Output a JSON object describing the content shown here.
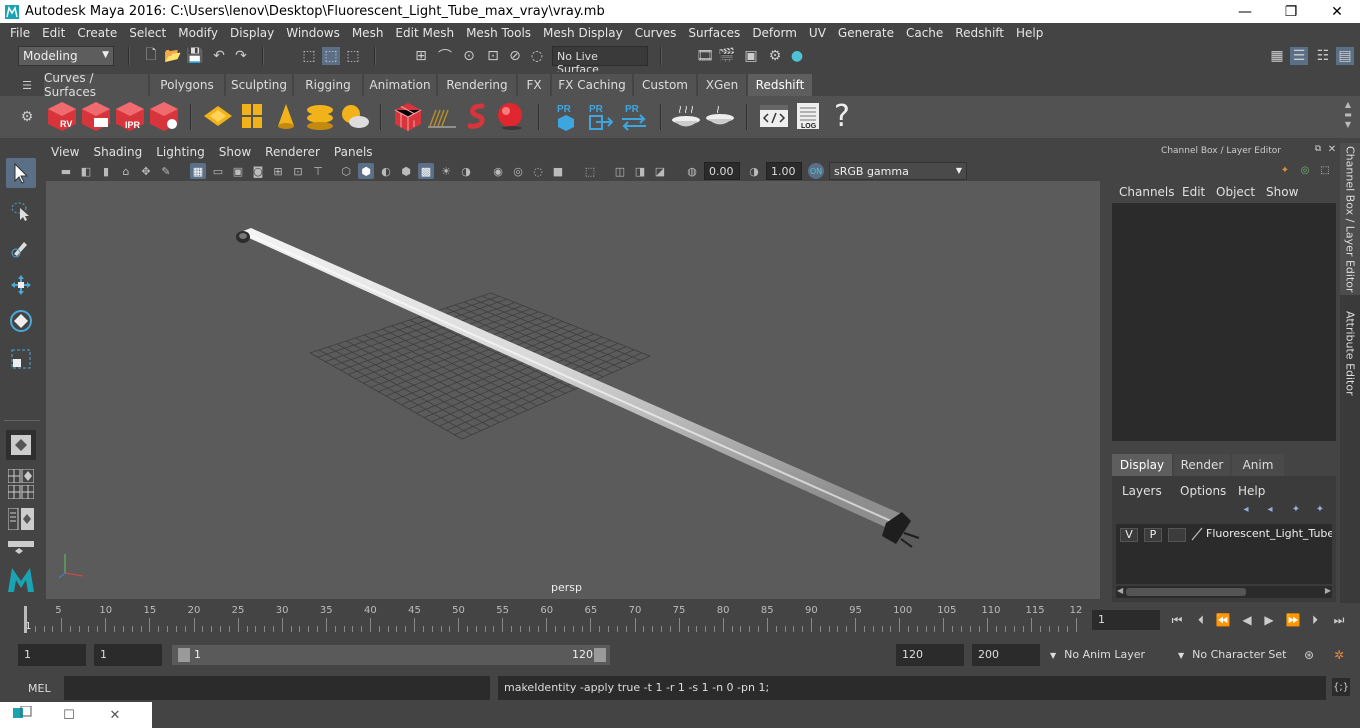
{
  "window": {
    "title": "Autodesk Maya 2016: C:\\Users\\lenov\\Desktop\\Fluorescent_Light_Tube_max_vray\\vray.mb",
    "minimize": "—",
    "maximize": "❐",
    "close": "✕"
  },
  "menubar": [
    "File",
    "Edit",
    "Create",
    "Select",
    "Modify",
    "Display",
    "Windows",
    "Mesh",
    "Edit Mesh",
    "Mesh Tools",
    "Mesh Display",
    "Curves",
    "Surfaces",
    "Deform",
    "UV",
    "Generate",
    "Cache",
    "Redshift",
    "Help"
  ],
  "status": {
    "mode": "Modeling",
    "live_surface": "No Live Surface"
  },
  "shelf_tabs": [
    "Curves / Surfaces",
    "Polygons",
    "Sculpting",
    "Rigging",
    "Animation",
    "Rendering",
    "FX",
    "FX Caching",
    "Custom",
    "XGen",
    "Redshift"
  ],
  "shelf_active": "Redshift",
  "shelf_labels": {
    "rv": "RV",
    "ipr": "IPR",
    "pr1": "PR",
    "pr2": "PR",
    "pr3": "PR",
    "log": "LOG",
    "help": "?"
  },
  "viewport": {
    "menu": [
      "View",
      "Shading",
      "Lighting",
      "Show",
      "Renderer",
      "Panels"
    ],
    "near": "0.00",
    "far": "1.00",
    "color_space": "sRGB gamma",
    "camera": "persp"
  },
  "right_panel": {
    "title": "Channel Box / Layer Editor",
    "channel_menu": [
      "Channels",
      "Edit",
      "Object",
      "Show"
    ],
    "layer_tabs": [
      "Display",
      "Render",
      "Anim"
    ],
    "layer_menu": [
      "Layers",
      "Options",
      "Help"
    ],
    "layer": {
      "v": "V",
      "p": "P",
      "name": "Fluorescent_Light_Tube_"
    }
  },
  "vertical_tabs": [
    "Channel Box / Layer Editor",
    "Attribute Editor"
  ],
  "timeline": {
    "ticks": [
      "5",
      "10",
      "15",
      "20",
      "25",
      "30",
      "35",
      "40",
      "45",
      "50",
      "55",
      "60",
      "65",
      "70",
      "75",
      "80",
      "85",
      "90",
      "95",
      "100",
      "105",
      "110",
      "115",
      "12"
    ],
    "start_marker": "1",
    "current_frame": "1"
  },
  "range": {
    "start": "1",
    "playback_start": "1",
    "inner_start": "1",
    "inner_end": "120",
    "playback_end": "120",
    "end": "200",
    "anim_layer": "No Anim Layer",
    "char_set": "No Character Set"
  },
  "command": {
    "label": "MEL",
    "result": "makeIdentity -apply true -t 1 -r 1 -s 1 -n 0 -pn 1;"
  }
}
